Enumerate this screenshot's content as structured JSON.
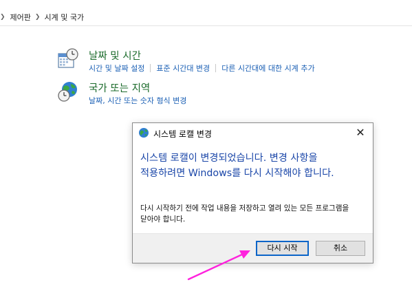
{
  "breadcrumb": {
    "items": [
      "제어판",
      "시계 및 국가"
    ]
  },
  "categories": [
    {
      "title": "날짜 및 시간",
      "icon": "calendar-clock-icon",
      "links": [
        "시간 및 날짜 설정",
        "표준 시간대 변경",
        "다른 시간대에 대한 시계 추가"
      ]
    },
    {
      "title": "국가 또는 지역",
      "icon": "globe-clock-icon",
      "links": [
        "날짜, 시간 또는 숫자 형식 변경"
      ]
    }
  ],
  "dialog": {
    "title": "시스템 로캘 변경",
    "icon": "globe-icon",
    "close_icon": "close-icon",
    "message": "시스템 로캘이 변경되었습니다. 변경 사항을 적용하려면 Windows를 다시 시작해야 합니다.",
    "sub_message": "다시 시작하기 전에 작업 내용을 저장하고 열려 있는 모든 프로그램을 닫아야 합니다.",
    "restart_button": "다시 시작",
    "cancel_button": "취소"
  },
  "colors": {
    "link": "#1a5fb4",
    "category_title": "#1a6a2a",
    "dialog_message": "#1a46a8",
    "annotation_arrow": "#ff22dd",
    "primary_button_border": "#0a64c8"
  }
}
